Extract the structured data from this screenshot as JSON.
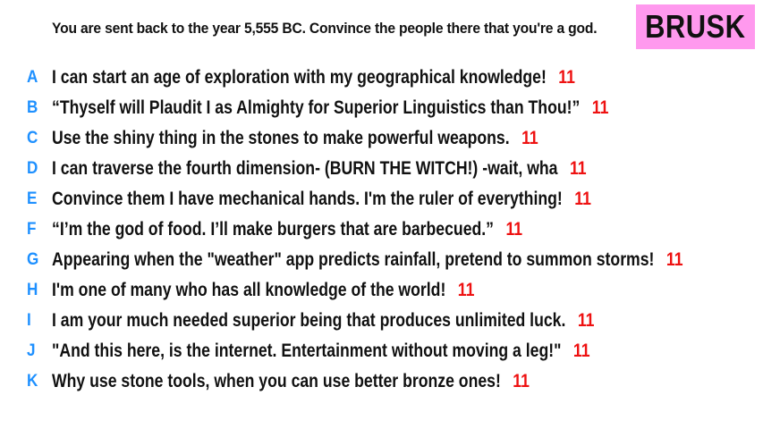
{
  "prompt": "You are sent back to the year 5,555 BC. Convince the people there that you're a god.",
  "badge": {
    "label": "BRUSK",
    "color": "#ff99ee"
  },
  "colors": {
    "letter": "#1e90ff",
    "score": "#ee1111",
    "text": "#111111"
  },
  "answers": [
    {
      "letter": "A",
      "text": "I can start an age of exploration with my geographical knowledge!",
      "score": "11"
    },
    {
      "letter": "B",
      "text": "“Thyself will Plaudit I as Almighty for Superior Linguistics than Thou!”",
      "score": "11"
    },
    {
      "letter": "C",
      "text": "Use the shiny thing in the stones to make powerful weapons.",
      "score": "11"
    },
    {
      "letter": "D",
      "text": "I can traverse the fourth dimension- (BURN THE WITCH!) -wait, wha",
      "score": "11"
    },
    {
      "letter": "E",
      "text": "Convince them I have mechanical hands. I'm the ruler of everything!",
      "score": "11"
    },
    {
      "letter": "F",
      "text": "“I’m the god of food. I’ll make burgers that are barbecued.”",
      "score": "11"
    },
    {
      "letter": "G",
      "text": "Appearing when the \"weather\" app predicts rainfall, pretend to summon storms!",
      "score": "11"
    },
    {
      "letter": "H",
      "text": "I'm one of many who has all knowledge of the world!",
      "score": "11"
    },
    {
      "letter": "I",
      "text": "I am your much needed superior being that produces unlimited luck.",
      "score": "11"
    },
    {
      "letter": "J",
      "text": "\"And this here, is the internet. Entertainment without moving a leg!\"",
      "score": "11"
    },
    {
      "letter": "K",
      "text": "Why use stone tools, when you can use better bronze ones!",
      "score": "11"
    }
  ]
}
